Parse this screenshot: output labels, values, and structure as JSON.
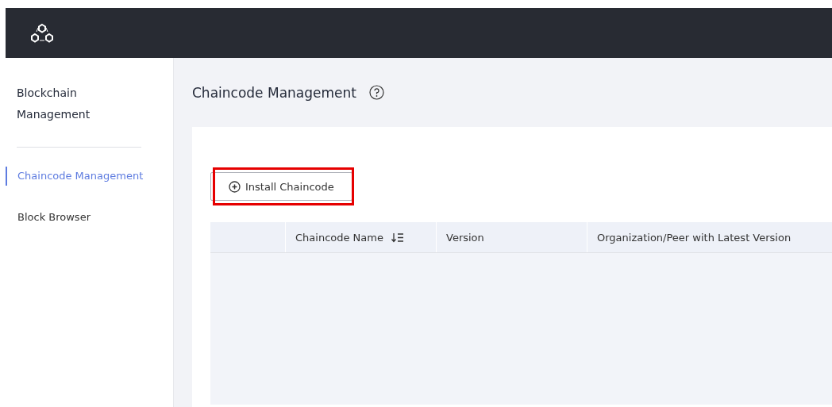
{
  "sidebar": {
    "title": "Blockchain Management",
    "items": [
      {
        "label": "Chaincode Management",
        "selected": true
      },
      {
        "label": "Block Browser",
        "selected": false
      }
    ]
  },
  "page": {
    "title": "Chaincode Management",
    "help_icon": true
  },
  "install_button": {
    "label": "Install Chaincode",
    "highlighted": true
  },
  "table": {
    "columns": [
      {
        "sortable": false
      },
      {
        "label": "Chaincode Name",
        "sortable": true
      },
      {
        "label": "Version",
        "sortable": false
      },
      {
        "label": "Organization/Peer with Latest Version",
        "sortable": false
      }
    ]
  }
}
